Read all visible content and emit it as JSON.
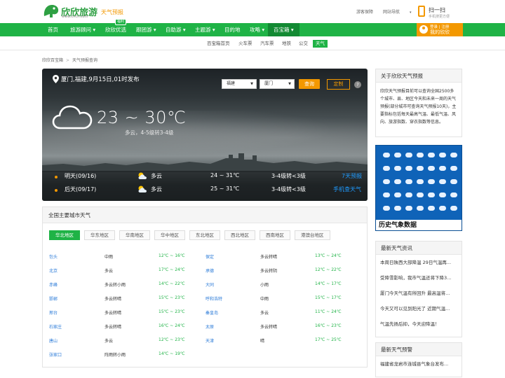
{
  "brand": {
    "name": "欣欣旅游",
    "url": "www.cncn.com",
    "section": "天气预报"
  },
  "toplinks": [
    "游客保障",
    "网站导航"
  ],
  "scan": {
    "title": "扫一扫",
    "sub": "手机搜更方便"
  },
  "login": {
    "line1": "登录 | 注册",
    "line2": "我的欣欣"
  },
  "nav": [
    {
      "label": "首页"
    },
    {
      "label": "旅游顾问",
      "caret": "▾"
    },
    {
      "label": "欣欣优选",
      "badge": "福利"
    },
    {
      "label": "跟团游",
      "caret": "▾"
    },
    {
      "label": "自助游",
      "caret": "▾"
    },
    {
      "label": "主题游",
      "caret": "▾"
    },
    {
      "label": "目的地"
    },
    {
      "label": "攻略",
      "caret": "▾"
    },
    {
      "label": "百宝箱",
      "caret": "▾"
    }
  ],
  "subnav": [
    "百宝箱首页",
    "火车票",
    "汽车票",
    "地铁",
    "公交",
    "天气"
  ],
  "breadcrumb": [
    "欣欣百宝箱",
    "天气预报查询"
  ],
  "hero": {
    "location": "厦门,福建,9月15日,01时发布",
    "province": "福建",
    "city": "厦门",
    "query_label": "查询",
    "custom_label": "定制",
    "help": "?",
    "temp": "23 ~ 30℃",
    "condition": "多云，4-5级转3-4级",
    "forecast": [
      {
        "day": "明天(09/16)",
        "weather": "多云",
        "temp": "24 ~ 31℃",
        "wind": "3-4级转<3级",
        "link": "7天预报"
      },
      {
        "day": "后天(09/17)",
        "weather": "多云",
        "temp": "25 ~ 31℃",
        "wind": "3-4级转<3级",
        "link": "手机查天气"
      }
    ]
  },
  "cities": {
    "title": "全国主要城市天气",
    "tabs": [
      "华北地区",
      "华东地区",
      "华南地区",
      "华中地区",
      "东北地区",
      "西北地区",
      "西南地区",
      "港澳台地区"
    ],
    "rows": [
      [
        {
          "city": "包头",
          "weather": "中雨",
          "temp": "12℃ ~ 16℃"
        },
        {
          "city": "保定",
          "weather": "多云转晴",
          "temp": "13℃ ~ 24℃"
        }
      ],
      [
        {
          "city": "北京",
          "weather": "多云",
          "temp": "17℃ ~ 24℃"
        },
        {
          "city": "承德",
          "weather": "多云转阴",
          "temp": "12℃ ~ 22℃"
        }
      ],
      [
        {
          "city": "赤峰",
          "weather": "多云转小雨",
          "temp": "14℃ ~ 22℃"
        },
        {
          "city": "大同",
          "weather": "小雨",
          "temp": "14℃ ~ 17℃"
        }
      ],
      [
        {
          "city": "邯郸",
          "weather": "多云转晴",
          "temp": "15℃ ~ 23℃"
        },
        {
          "city": "呼和浩特",
          "weather": "中雨",
          "temp": "15℃ ~ 17℃"
        }
      ],
      [
        {
          "city": "邢台",
          "weather": "多云转晴",
          "temp": "15℃ ~ 23℃"
        },
        {
          "city": "秦皇岛",
          "weather": "多云",
          "temp": "11℃ ~ 24℃"
        }
      ],
      [
        {
          "city": "石家庄",
          "weather": "多云转晴",
          "temp": "16℃ ~ 24℃"
        },
        {
          "city": "太原",
          "weather": "多云转晴",
          "temp": "16℃ ~ 23℃"
        }
      ],
      [
        {
          "city": "唐山",
          "weather": "多云",
          "temp": "12℃ ~ 23℃"
        },
        {
          "city": "天津",
          "weather": "晴",
          "temp": "17℃ ~ 25℃"
        }
      ],
      [
        {
          "city": "张家口",
          "weather": "阵雨转小雨",
          "temp": "14℃ ~ 19℃"
        }
      ]
    ]
  },
  "about": {
    "title": "关于欣欣天气预报",
    "text": "欣欣天气预报目前可以查询全国2500多个城市、县、地区今天和未来一周的天气预报(部分城市可查询天气预报10天)，主要指标包括每天最高气温、最低气温、风向、旅游指数、穿衣指数等信息。"
  },
  "ad": {
    "caption": "历史气象数据"
  },
  "news": {
    "title": "最新天气资讯",
    "items": [
      "本周日陕西大部降温 29日气温再...",
      "受降雪影响，我市气温还将下降3...",
      "厦门今天气温有所回升 最高温将...",
      "今天又可以见到阳光了 近期气温...",
      "气温先扬后抑，今天迎降温！"
    ]
  },
  "warnings": {
    "title": "最新天气预警",
    "items": [
      "福建省龙岩市连城县气象台发布..."
    ]
  }
}
